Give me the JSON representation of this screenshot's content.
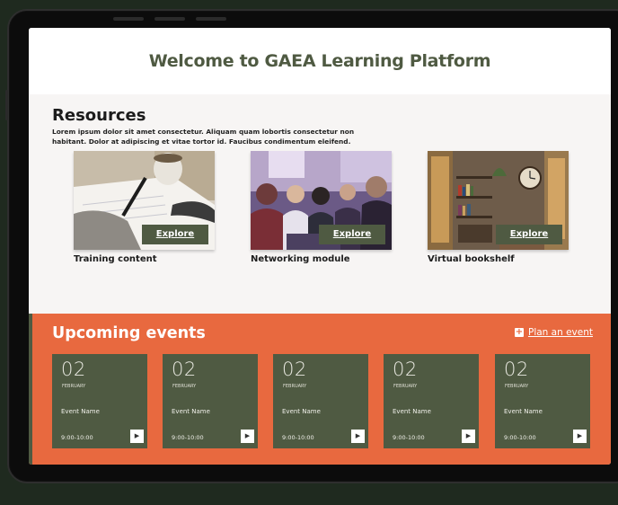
{
  "header": {
    "title": "Welcome to GAEA Learning Platform"
  },
  "resources": {
    "title": "Resources",
    "description": "Lorem ipsum dolor sit amet consectetur. Aliquam quam lobortis consectetur non habitant. Dolor at adipiscing et vitae tortor id. Faucibus condimentum eleifend.",
    "cards": [
      {
        "title": "Training content",
        "button": "Explore",
        "image": "writing-notes-image"
      },
      {
        "title": "Networking module",
        "button": "Explore",
        "image": "people-meeting-image"
      },
      {
        "title": "Virtual bookshelf",
        "button": "Explore",
        "image": "bookshelf-room-image"
      }
    ]
  },
  "events": {
    "title": "Upcoming events",
    "plan_label": "Plan an event",
    "items": [
      {
        "day": "02",
        "month": "FEBRUARY",
        "name": "Event Name",
        "time": "9:00-10:00"
      },
      {
        "day": "02",
        "month": "FEBRUARY",
        "name": "Event Name",
        "time": "9:00-10:00"
      },
      {
        "day": "02",
        "month": "FEBRUARY",
        "name": "Event Name",
        "time": "9:00-10:00"
      },
      {
        "day": "02",
        "month": "FEBRUARY",
        "name": "Event Name",
        "time": "9:00-10:00"
      },
      {
        "day": "02",
        "month": "FEBRUARY",
        "name": "Event Name",
        "time": "9:00-10:00"
      }
    ]
  },
  "colors": {
    "accent_green": "#4f5a42",
    "accent_orange": "#e8693f",
    "background": "#1f2a1f"
  }
}
